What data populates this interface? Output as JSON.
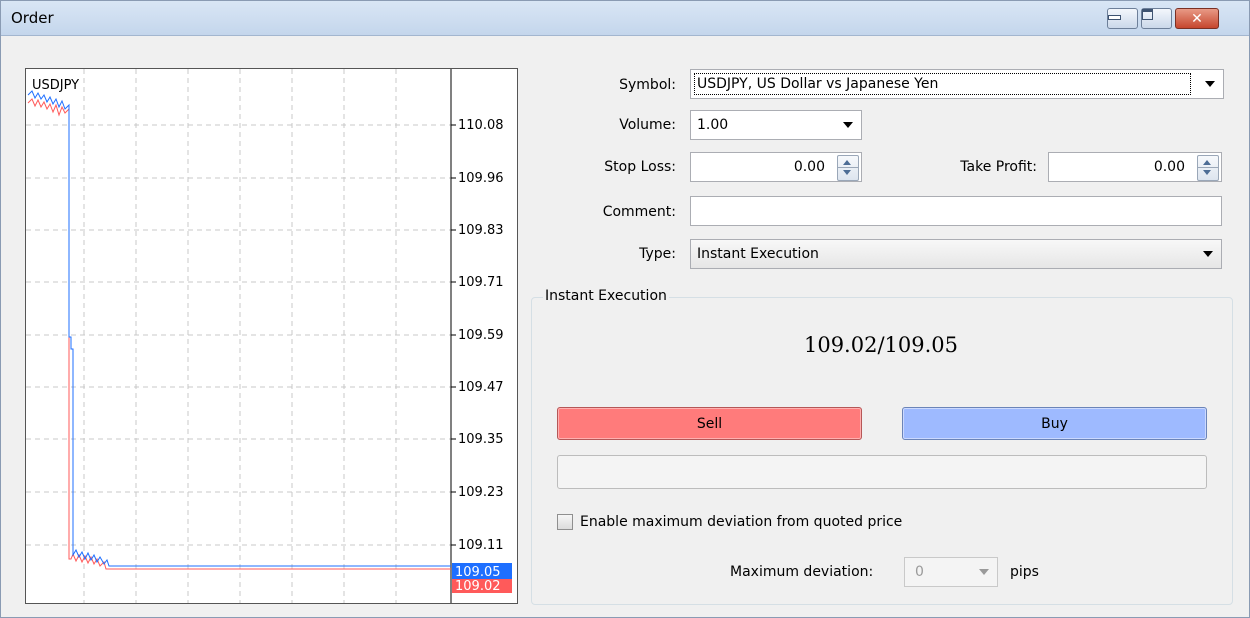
{
  "window": {
    "title": "Order"
  },
  "chart": {
    "symbol": "USDJPY",
    "price_axis": [
      "110.08",
      "109.96",
      "109.83",
      "109.71",
      "109.59",
      "109.47",
      "109.35",
      "109.23",
      "109.11"
    ],
    "ask_label": "109.05",
    "bid_label": "109.02",
    "ask_color": "#1e6fff",
    "bid_color": "#ff5a5a"
  },
  "form": {
    "symbol_label": "Symbol:",
    "symbol_value": "USDJPY, US Dollar vs Japanese Yen",
    "volume_label": "Volume:",
    "volume_value": "1.00",
    "stoploss_label": "Stop Loss:",
    "stoploss_value": "0.00",
    "takeprofit_label": "Take Profit:",
    "takeprofit_value": "0.00",
    "comment_label": "Comment:",
    "comment_value": "",
    "type_label": "Type:",
    "type_value": "Instant Execution"
  },
  "execution": {
    "group_label": "Instant Execution",
    "quote": "109.02/109.05",
    "sell_label": "Sell",
    "buy_label": "Buy",
    "sell_color": "#ff7b7b",
    "buy_color": "#9ebaff",
    "deviation_checkbox_label": "Enable maximum deviation from quoted price",
    "deviation_checked": false,
    "max_deviation_label": "Maximum deviation:",
    "max_deviation_value": "0",
    "pips_label": "pips"
  }
}
